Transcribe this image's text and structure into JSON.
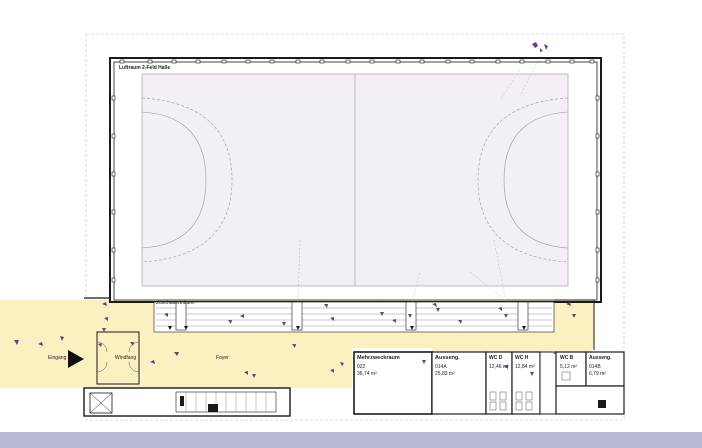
{
  "colors": {
    "court": "#f4eef6",
    "foyer": "#fbf0bf",
    "figures": "#6a3d8c",
    "walls": "#1a1a1a",
    "bottom_bar": "#b7b8d3"
  },
  "labels": {
    "hall": "Luftraum 2-Feld Halle",
    "tribune": "Zuschauertribüne",
    "entrance": "Eingang",
    "windfang": "Windfang",
    "foyer": "Foyer"
  },
  "rooms": [
    {
      "name": "Mehrzweckraum",
      "number": "022",
      "area": "36,74 m²"
    },
    {
      "name": "Ausseng.",
      "number": "014A",
      "area": "25,83 m²"
    },
    {
      "name": "WC D",
      "number": "",
      "area": "12,46 m²"
    },
    {
      "name": "WC H",
      "number": "",
      "area": "12,84 m²"
    },
    {
      "name": "WC B",
      "number": "",
      "area": "5,12 m²"
    },
    {
      "name": "Ausseng.",
      "number": "014B",
      "area": "6,79 m²"
    }
  ],
  "icons": {
    "entrance_arrow": "entrance-arrow-icon",
    "person": "person-figure-icon",
    "stair": "stair-icon",
    "elevator": "elevator-icon"
  }
}
